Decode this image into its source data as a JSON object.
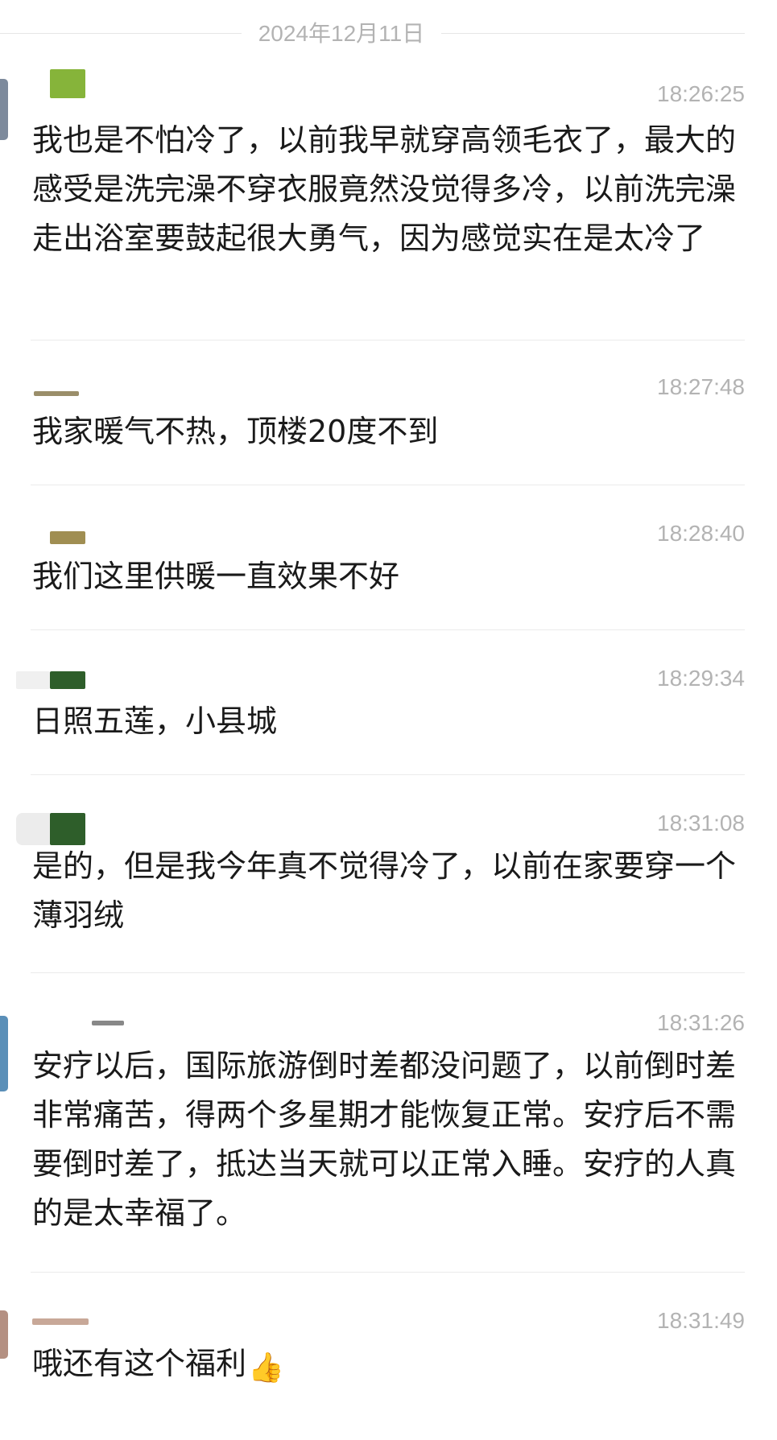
{
  "date_divider": "2024年12月11日",
  "messages": [
    {
      "time": "18:26:25",
      "content": "我也是不怕冷了，以前我早就穿高领毛衣了，最大的感受是洗完澡不穿衣服竟然没觉得多冷，以前洗完澡走出浴室要鼓起很大勇气，因为感觉实在是太冷了"
    },
    {
      "time": "18:27:48",
      "content": "我家暖气不热，顶楼20度不到"
    },
    {
      "time": "18:28:40",
      "content": "我们这里供暖一直效果不好"
    },
    {
      "time": "18:29:34",
      "content": "日照五莲，小县城"
    },
    {
      "time": "18:31:08",
      "content": "是的，但是我今年真不觉得冷了，以前在家要穿一个薄羽绒"
    },
    {
      "time": "18:31:26",
      "content": "安疗以后，国际旅游倒时差都没问题了，以前倒时差非常痛苦，得两个多星期才能恢复正常。安疗后不需要倒时差了，抵达当天就可以正常入睡。安疗的人真的是太幸福了。"
    },
    {
      "time": "18:31:49",
      "content": "哦还有这个福利",
      "emoji": "👍"
    }
  ]
}
